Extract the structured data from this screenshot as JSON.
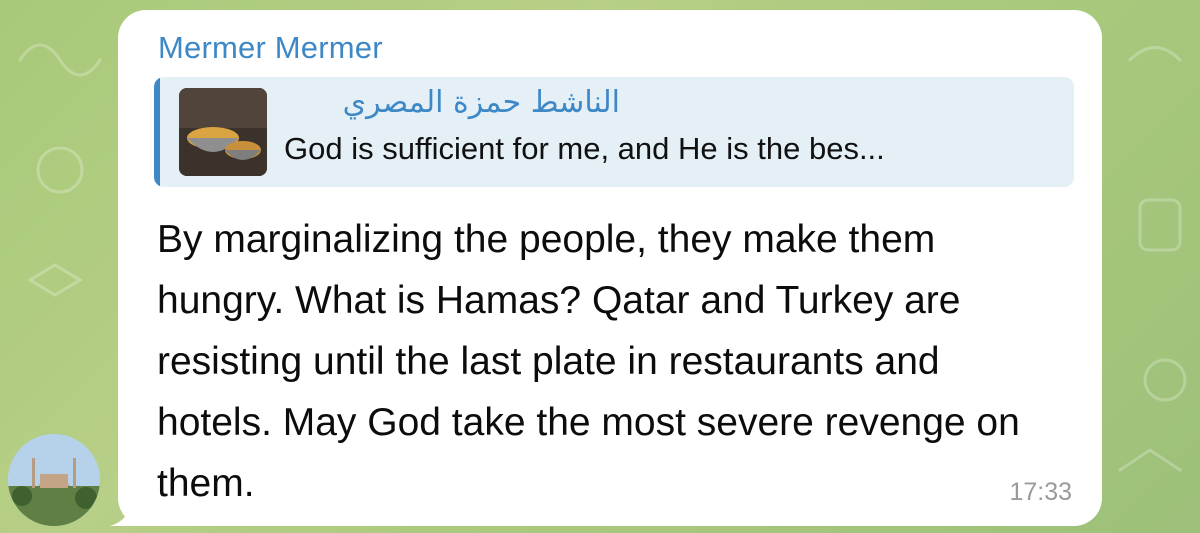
{
  "chat": {
    "sender_name": "Mermer Mermer",
    "reply": {
      "author": "الناشط حمزة المصري",
      "preview": "God is sufficient for me, and He is the bes..."
    },
    "message_text": "By marginalizing the people, they make them hungry. What is Hamas? Qatar and Turkey are resisting until the last plate in restaurants and hotels. May God take the most severe revenge on them.",
    "time": "17:33"
  },
  "colors": {
    "accent": "#3e88c6",
    "bubble": "#ffffff",
    "reply_background": "#e4f0f6",
    "wallpaper": "#a9c97c"
  },
  "icons": {
    "avatar": "mosque-photo-avatar",
    "reply_thumbnail": "food-pot-photo"
  }
}
